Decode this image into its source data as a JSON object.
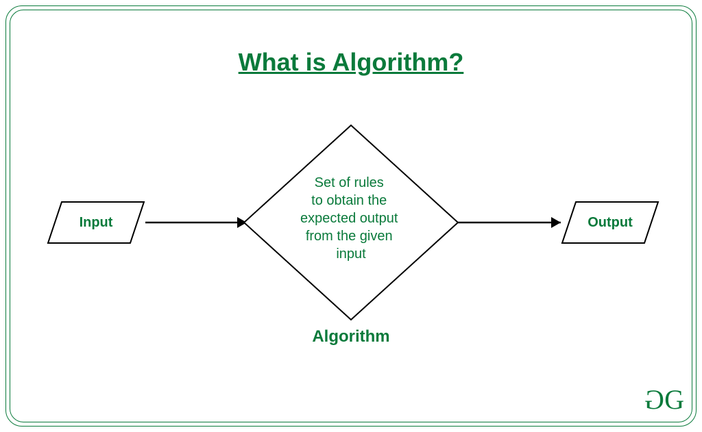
{
  "title": "What is Algorithm?",
  "flow": {
    "input_label": "Input",
    "process_text": "Set of rules to obtain the expected output from the given input",
    "process_caption": "Algorithm",
    "output_label": "Output"
  },
  "colors": {
    "accent": "#0a7a3b",
    "stroke": "#000000"
  }
}
